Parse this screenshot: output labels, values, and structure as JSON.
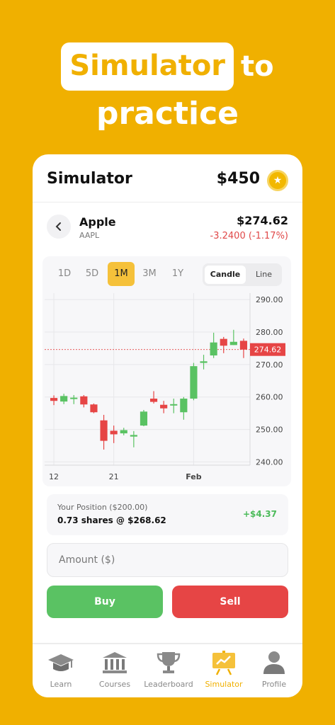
{
  "headline": {
    "highlight": "Simulator",
    "rest": "to",
    "line2": "practice"
  },
  "card": {
    "title": "Simulator",
    "balance": "$450",
    "coin_icon": "star"
  },
  "stock": {
    "name": "Apple",
    "ticker": "AAPL",
    "price": "$274.62",
    "change": "-3.2400 (-1.17%)"
  },
  "timeframes": [
    "1D",
    "5D",
    "1M",
    "3M",
    "1Y"
  ],
  "active_timeframe": "1M",
  "chart_mode": {
    "options": [
      "Candle",
      "Line"
    ],
    "selected": "Candle"
  },
  "chart_data": {
    "type": "candlestick",
    "y_ticks": [
      "290.00",
      "280.00",
      "270.00",
      "260.00",
      "250.00",
      "240.00"
    ],
    "x_ticks": [
      "12",
      "21",
      "Feb"
    ],
    "current_price_label": "274.62",
    "current_price": 274.62,
    "ylim": [
      239,
      292
    ],
    "candles": [
      {
        "o": 259.7,
        "c": 258.8,
        "h": 260.5,
        "l": 257.5
      },
      {
        "o": 258.6,
        "c": 260.3,
        "h": 261.0,
        "l": 257.8
      },
      {
        "o": 259.6,
        "c": 259.8,
        "h": 260.6,
        "l": 257.8
      },
      {
        "o": 260.2,
        "c": 257.7,
        "h": 260.6,
        "l": 256.8
      },
      {
        "o": 257.7,
        "c": 255.3,
        "h": 258.0,
        "l": 255.0
      },
      {
        "o": 252.8,
        "c": 246.5,
        "h": 254.5,
        "l": 243.8
      },
      {
        "o": 249.6,
        "c": 248.5,
        "h": 251.2,
        "l": 245.8
      },
      {
        "o": 248.8,
        "c": 249.8,
        "h": 250.5,
        "l": 248.2
      },
      {
        "o": 247.8,
        "c": 248.3,
        "h": 249.5,
        "l": 244.5
      },
      {
        "o": 251.2,
        "c": 255.5,
        "h": 256.0,
        "l": 251.0
      },
      {
        "o": 259.5,
        "c": 258.5,
        "h": 261.8,
        "l": 258.0
      },
      {
        "o": 257.6,
        "c": 256.5,
        "h": 258.8,
        "l": 255.0
      },
      {
        "o": 257.6,
        "c": 257.8,
        "h": 259.5,
        "l": 255.0
      },
      {
        "o": 255.3,
        "c": 259.5,
        "h": 260.0,
        "l": 253.0
      },
      {
        "o": 259.5,
        "c": 269.5,
        "h": 270.5,
        "l": 259.0
      },
      {
        "o": 270.5,
        "c": 271.0,
        "h": 273.0,
        "l": 268.5
      },
      {
        "o": 272.8,
        "c": 276.8,
        "h": 279.8,
        "l": 272.0
      },
      {
        "o": 277.9,
        "c": 275.8,
        "h": 278.5,
        "l": 273.5
      },
      {
        "o": 276.0,
        "c": 277.0,
        "h": 280.7,
        "l": 276.0
      },
      {
        "o": 277.3,
        "c": 274.6,
        "h": 278.0,
        "l": 272.0
      }
    ]
  },
  "position": {
    "label": "Your Position ($200.00)",
    "shares": "0.73 shares @ $268.62",
    "gain": "+$4.37"
  },
  "amount": {
    "placeholder": "Amount ($)"
  },
  "buttons": {
    "buy": "Buy",
    "sell": "Sell"
  },
  "colors": {
    "accent": "#F0B000",
    "up": "#5AC263",
    "down": "#E64545"
  },
  "tabs": [
    {
      "label": "Learn",
      "icon": "graduation-cap-icon"
    },
    {
      "label": "Courses",
      "icon": "bank-icon"
    },
    {
      "label": "Leaderboard",
      "icon": "trophy-icon"
    },
    {
      "label": "Simulator",
      "icon": "chart-board-icon"
    },
    {
      "label": "Profile",
      "icon": "user-icon"
    }
  ],
  "active_tab": "Simulator"
}
